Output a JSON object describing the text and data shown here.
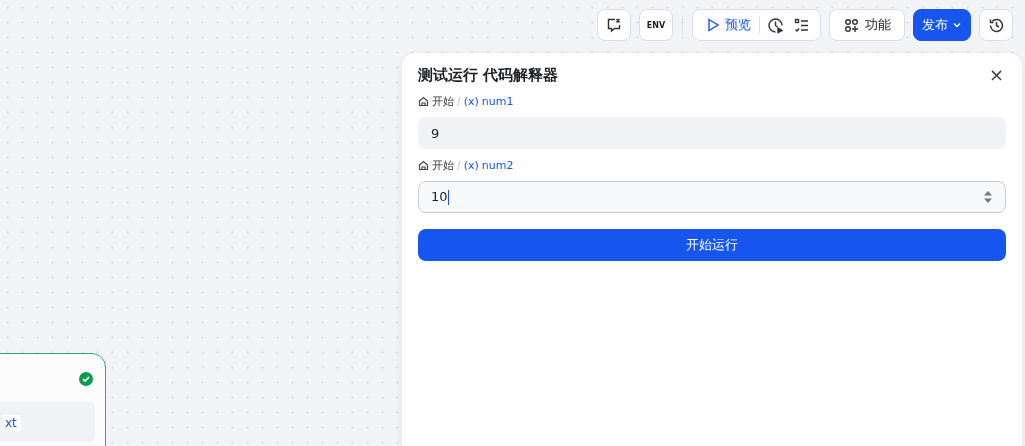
{
  "toolbar": {
    "env_label": "ENV",
    "preview_label": "预览",
    "feature_label": "功能",
    "publish_label": "发布"
  },
  "panel": {
    "title": "测试运行 代码解释器",
    "close": "×",
    "fields": [
      {
        "source": "开始",
        "separator": "/",
        "var_mark": "(x)",
        "var_name": "num1",
        "value": "9",
        "focused": false,
        "kind": "text"
      },
      {
        "source": "开始",
        "separator": "/",
        "var_mark": "(x)",
        "var_name": "num2",
        "value": "10",
        "focused": true,
        "kind": "number"
      }
    ],
    "run_button": "开始运行"
  },
  "node": {
    "success": true,
    "tag": "xt"
  }
}
